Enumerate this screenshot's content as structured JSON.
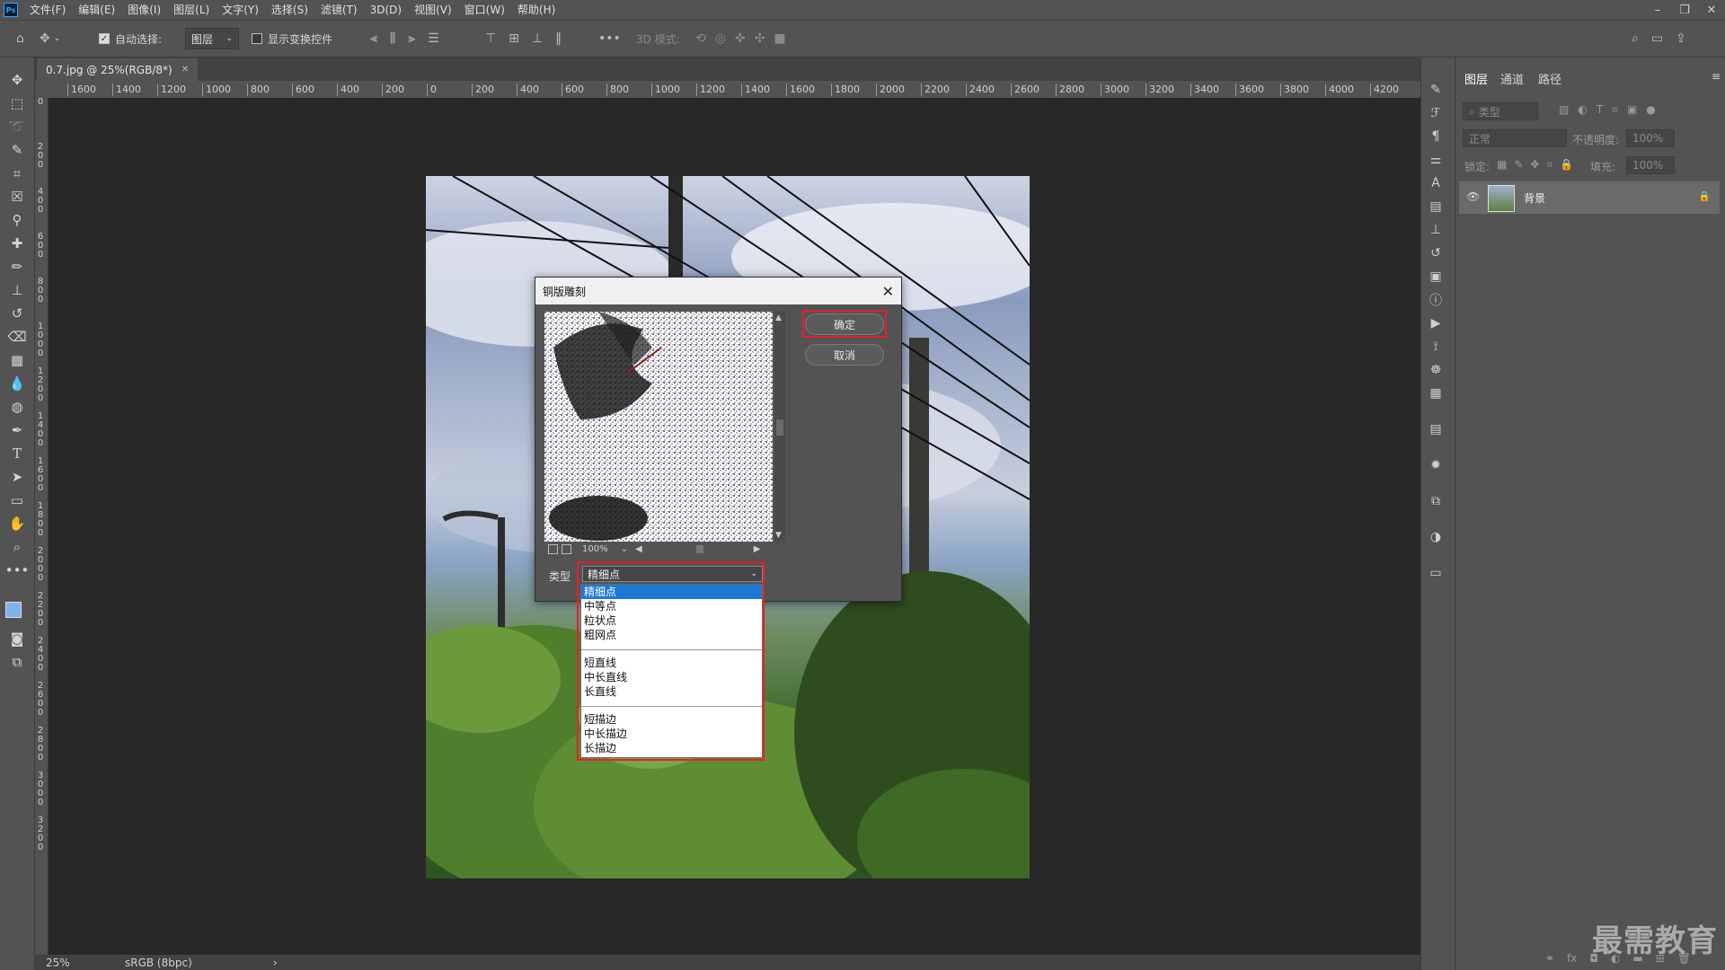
{
  "app": {
    "logo": "Ps"
  },
  "menu": [
    "文件(F)",
    "编辑(E)",
    "图像(I)",
    "图层(L)",
    "文字(Y)",
    "选择(S)",
    "滤镜(T)",
    "3D(D)",
    "视图(V)",
    "窗口(W)",
    "帮助(H)"
  ],
  "options_bar": {
    "auto_select_label": "自动选择:",
    "auto_select_checked": true,
    "layer_select_value": "图层",
    "show_transform_label": "显示变换控件",
    "mode_3d_label": "3D 模式:"
  },
  "document": {
    "tab_title": "0.7.jpg @ 25%(RGB/8*)",
    "zoom": "25%",
    "color_profile": "sRGB (8bpc)",
    "ruler_h": [
      "1600",
      "1400",
      "1200",
      "1000",
      "800",
      "600",
      "400",
      "200",
      "0",
      "200",
      "400",
      "600",
      "800",
      "1000",
      "1200",
      "1400",
      "1600",
      "1800",
      "2000",
      "2200",
      "2400",
      "2600",
      "2800",
      "3000",
      "3200",
      "3400",
      "3600",
      "3800",
      "4000",
      "4200"
    ],
    "ruler_v": [
      "0",
      "2 0 0",
      "4 0 0",
      "6 0 0",
      "8 0 0",
      "1 0 0 0",
      "1 2 0 0",
      "1 4 0 0",
      "1 6 0 0",
      "1 8 0 0",
      "2 0 0 0",
      "2 2 0 0",
      "2 4 0 0",
      "2 6 0 0",
      "2 8 0 0",
      "3 0 0 0",
      "3 2 0 0"
    ]
  },
  "dialog": {
    "title": "铜版雕刻",
    "ok_label": "确定",
    "cancel_label": "取消",
    "preview_zoom": "100%",
    "type_label": "类型",
    "type_value": "精细点",
    "type_options_group1": [
      "精细点",
      "中等点",
      "粒状点",
      "粗网点"
    ],
    "type_options_group2": [
      "短直线",
      "中长直线",
      "长直线"
    ],
    "type_options_group3": [
      "短描边",
      "中长描边",
      "长描边"
    ],
    "selected_option": "精细点"
  },
  "layers_panel": {
    "tabs": [
      "图层",
      "通道",
      "路径"
    ],
    "filter_placeholder": "类型",
    "blend_mode": "正常",
    "opacity_label": "不透明度:",
    "opacity_value": "100%",
    "lock_label": "锁定:",
    "fill_label": "填充:",
    "fill_value": "100%",
    "layer_name": "背景"
  },
  "watermark": "最需教育",
  "colors": {
    "accent_red": "#e8202a",
    "selection_blue": "#1e78d6"
  }
}
